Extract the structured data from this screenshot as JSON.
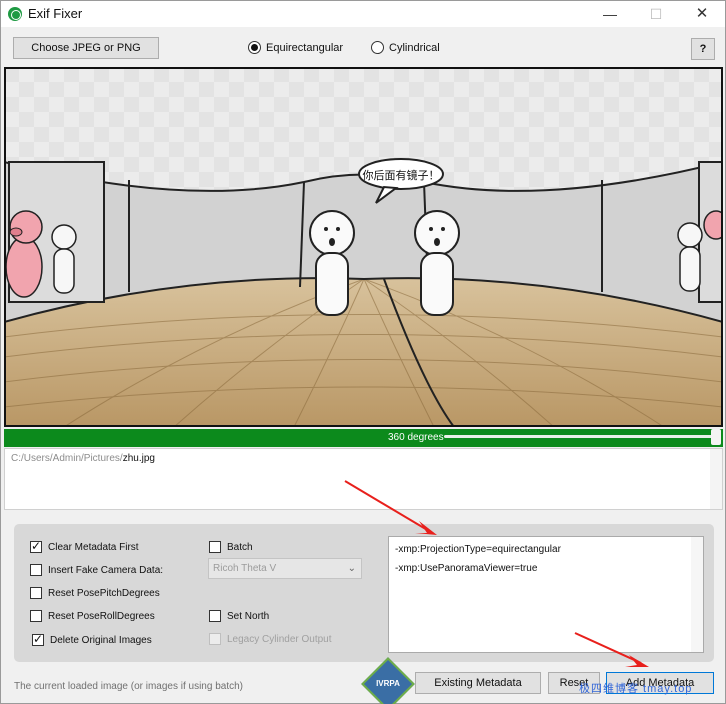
{
  "window": {
    "title": "Exif Fixer",
    "minimize": "—",
    "maximize": "☐",
    "close": "✕"
  },
  "toolbar": {
    "choose_label": "Choose JPEG or PNG",
    "radio_equirect": "Equirectangular",
    "radio_cylindrical": "Cylindrical",
    "selected": "Equirectangular",
    "help_label": "?"
  },
  "preview": {
    "speech_bubble": "你后面有镜子！"
  },
  "slider": {
    "label": "360 degrees",
    "value_fraction": 1.0
  },
  "file": {
    "path_prefix": "C:/Users/Admin/Pictures/",
    "filename": "zhu.jpg"
  },
  "options": {
    "clear_metadata": {
      "label": "Clear Metadata First",
      "checked": true
    },
    "insert_fake_camera": {
      "label": "Insert Fake Camera Data:",
      "checked": false
    },
    "reset_pose_pitch": {
      "label": "Reset PosePitchDegrees",
      "checked": false
    },
    "reset_pose_roll": {
      "label": "Reset PoseRollDegrees",
      "checked": false
    },
    "delete_originals": {
      "label": "Delete Original Images",
      "checked": true
    },
    "batch": {
      "label": "Batch",
      "checked": false
    },
    "camera_select": {
      "value": "Ricoh Theta V"
    },
    "set_north": {
      "label": "Set North",
      "checked": false
    },
    "legacy_cylinder": {
      "label": "Legacy Cylinder Output",
      "checked": false,
      "disabled": true
    }
  },
  "metadata_lines": [
    "-xmp:ProjectionType=equirectangular",
    "-xmp:UsePanoramaViewer=true"
  ],
  "footer": {
    "status": "The current loaded image (or images if using batch)",
    "logo_text": "IVRPA",
    "existing_label": "Existing Metadata",
    "reset_label": "Reset",
    "add_label": "Add Metadata",
    "watermark": "极四维博客 tmay.top"
  },
  "colors": {
    "slider_green": "#0c8a1c",
    "annotation_red": "#e8201c",
    "accent_blue": "#0078d7"
  }
}
